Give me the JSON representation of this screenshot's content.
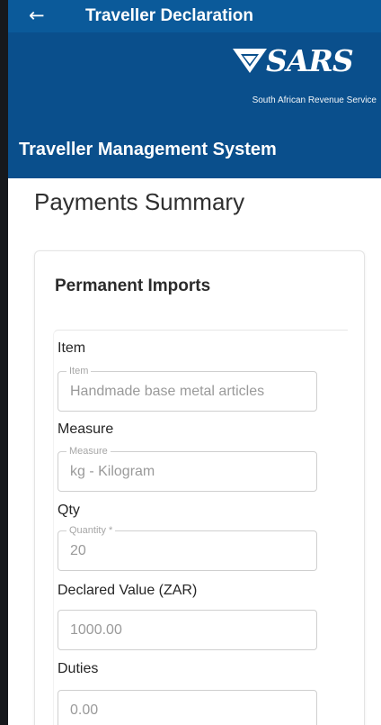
{
  "appbar": {
    "title": "Traveller Declaration",
    "back_icon": "arrow-left-icon"
  },
  "brand": {
    "logo_text": "SARS",
    "subtitle": "South African Revenue Service",
    "system_name": "Traveller Management System",
    "colors": {
      "appbar": "#0b5a9a",
      "header": "#0a4f8c"
    }
  },
  "page": {
    "title": "Payments Summary"
  },
  "card": {
    "title": "Permanent Imports",
    "item": {
      "label": "Item",
      "legend": "Item",
      "value": "Handmade base metal articles"
    },
    "measure": {
      "label": "Measure",
      "legend": "Measure",
      "value": "kg - Kilogram"
    },
    "qty": {
      "label": "Qty",
      "legend": "Quantity *",
      "value": "20"
    },
    "declared": {
      "label": "Declared Value (ZAR)",
      "value": "1000.00"
    },
    "duties": {
      "label": "Duties",
      "value": "0.00"
    }
  }
}
